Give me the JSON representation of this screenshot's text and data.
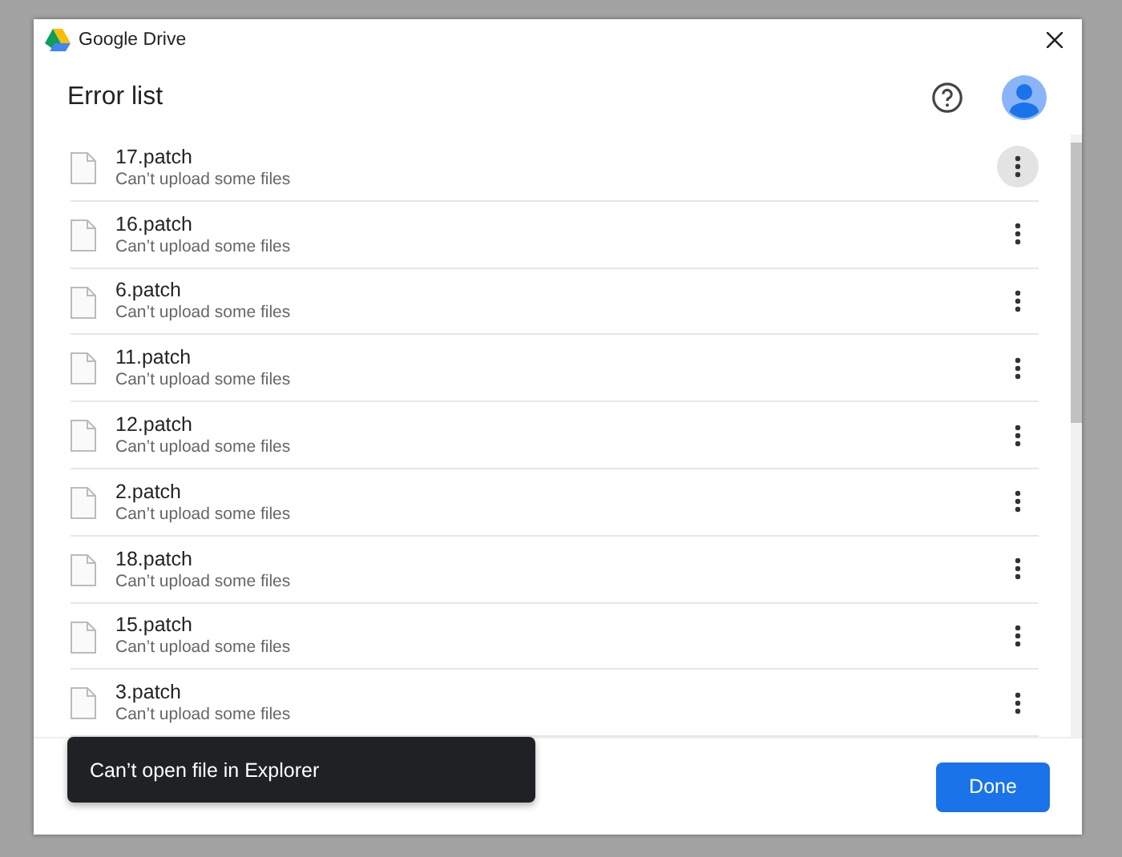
{
  "window": {
    "title": "Google Drive"
  },
  "header": {
    "title": "Error list"
  },
  "files": [
    {
      "name": "17.patch",
      "status": "Can’t upload some files",
      "hovered": true
    },
    {
      "name": "16.patch",
      "status": "Can’t upload some files",
      "hovered": false
    },
    {
      "name": "6.patch",
      "status": "Can’t upload some files",
      "hovered": false
    },
    {
      "name": "11.patch",
      "status": "Can’t upload some files",
      "hovered": false
    },
    {
      "name": "12.patch",
      "status": "Can’t upload some files",
      "hovered": false
    },
    {
      "name": "2.patch",
      "status": "Can’t upload some files",
      "hovered": false
    },
    {
      "name": "18.patch",
      "status": "Can’t upload some files",
      "hovered": false
    },
    {
      "name": "15.patch",
      "status": "Can’t upload some files",
      "hovered": false
    },
    {
      "name": "3.patch",
      "status": "Can’t upload some files",
      "hovered": false
    }
  ],
  "toast": {
    "message": "Can’t open file in Explorer"
  },
  "buttons": [
    {
      "label": "Done"
    }
  ]
}
